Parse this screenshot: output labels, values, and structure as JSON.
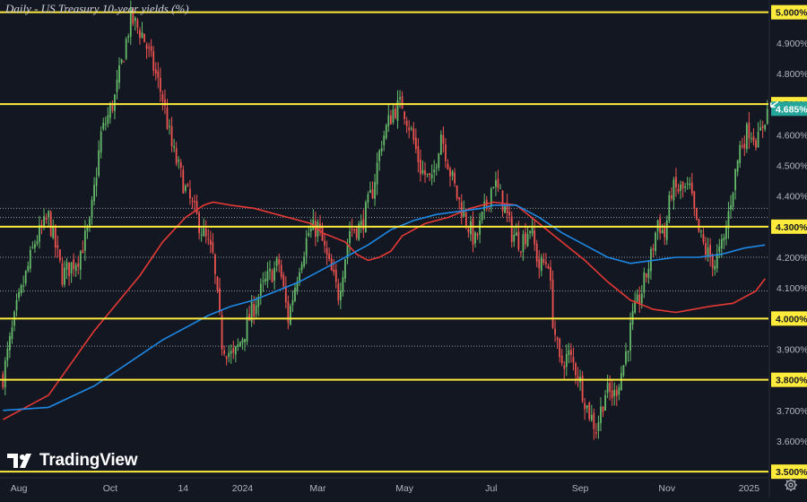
{
  "chart_data": {
    "type": "candlestick",
    "title": "Daily - US Treasury 10-year yields (%)",
    "ylim": [
      3.48,
      5.04
    ],
    "y_ticks": [
      "5.000%",
      "4.900%",
      "4.800%",
      "4.700%",
      "4.600%",
      "4.500%",
      "4.400%",
      "4.300%",
      "4.200%",
      "4.100%",
      "4.000%",
      "3.900%",
      "3.800%",
      "3.700%",
      "3.600%",
      "3.500%"
    ],
    "y_tick_values": [
      5.0,
      4.9,
      4.8,
      4.7,
      4.6,
      4.5,
      4.4,
      4.3,
      4.2,
      4.1,
      4.0,
      3.9,
      3.8,
      3.7,
      3.6,
      3.5
    ],
    "x_ticks": [
      "Aug",
      "Oct",
      "14",
      "2024",
      "Mar",
      "May",
      "Jul",
      "Sep",
      "Nov",
      "2025"
    ],
    "x_tick_index": [
      7,
      47,
      79,
      105,
      138,
      176,
      214,
      253,
      291,
      327
    ],
    "num_bars": 336,
    "current_price": {
      "label": "4.685%",
      "value": 4.685
    },
    "horizontal_levels": [
      {
        "value": 5.0,
        "label": "5.000%",
        "style": "solid"
      },
      {
        "value": 4.7,
        "label": "4.700%",
        "style": "solid"
      },
      {
        "value": 4.3,
        "label": "4.300%",
        "style": "solid"
      },
      {
        "value": 4.0,
        "label": "4.000%",
        "style": "solid"
      },
      {
        "value": 3.8,
        "label": "3.800%",
        "style": "solid"
      },
      {
        "value": 3.5,
        "label": "3.500%",
        "style": "solid"
      }
    ],
    "dotted_levels": [
      4.36,
      4.33,
      4.2,
      4.09,
      3.91
    ],
    "close_anchors": [
      [
        0,
        3.81
      ],
      [
        6,
        4.03
      ],
      [
        14,
        4.25
      ],
      [
        20,
        4.33
      ],
      [
        26,
        4.14
      ],
      [
        33,
        4.2
      ],
      [
        38,
        4.3
      ],
      [
        43,
        4.6
      ],
      [
        49,
        4.72
      ],
      [
        56,
        4.98
      ],
      [
        61,
        4.93
      ],
      [
        66,
        4.82
      ],
      [
        70,
        4.72
      ],
      [
        74,
        4.56
      ],
      [
        80,
        4.42
      ],
      [
        86,
        4.31
      ],
      [
        92,
        4.2
      ],
      [
        96,
        3.92
      ],
      [
        101,
        3.87
      ],
      [
        106,
        3.96
      ],
      [
        111,
        4.06
      ],
      [
        116,
        4.13
      ],
      [
        121,
        4.18
      ],
      [
        125,
        4.0
      ],
      [
        130,
        4.18
      ],
      [
        134,
        4.28
      ],
      [
        138,
        4.3
      ],
      [
        143,
        4.17
      ],
      [
        147,
        4.08
      ],
      [
        152,
        4.29
      ],
      [
        157,
        4.3
      ],
      [
        162,
        4.42
      ],
      [
        166,
        4.58
      ],
      [
        171,
        4.68
      ],
      [
        175,
        4.7
      ],
      [
        179,
        4.61
      ],
      [
        183,
        4.49
      ],
      [
        188,
        4.44
      ],
      [
        192,
        4.61
      ],
      [
        196,
        4.48
      ],
      [
        199,
        4.4
      ],
      [
        203,
        4.32
      ],
      [
        207,
        4.25
      ],
      [
        211,
        4.35
      ],
      [
        215,
        4.45
      ],
      [
        219,
        4.38
      ],
      [
        223,
        4.28
      ],
      [
        227,
        4.25
      ],
      [
        231,
        4.3
      ],
      [
        235,
        4.17
      ],
      [
        239,
        4.19
      ],
      [
        241,
        4.0
      ],
      [
        244,
        3.85
      ],
      [
        248,
        3.88
      ],
      [
        252,
        3.82
      ],
      [
        256,
        3.71
      ],
      [
        260,
        3.64
      ],
      [
        264,
        3.76
      ],
      [
        268,
        3.75
      ],
      [
        272,
        3.85
      ],
      [
        276,
        4.0
      ],
      [
        280,
        4.09
      ],
      [
        284,
        4.2
      ],
      [
        287,
        4.32
      ],
      [
        290,
        4.27
      ],
      [
        293,
        4.42
      ],
      [
        297,
        4.42
      ],
      [
        301,
        4.42
      ],
      [
        304,
        4.3
      ],
      [
        308,
        4.22
      ],
      [
        312,
        4.18
      ],
      [
        316,
        4.25
      ],
      [
        319,
        4.39
      ],
      [
        323,
        4.56
      ],
      [
        327,
        4.62
      ],
      [
        331,
        4.58
      ],
      [
        335,
        4.685
      ]
    ],
    "series": [
      {
        "name": "",
        "color": "#e53935",
        "points": [
          [
            0,
            3.67
          ],
          [
            20,
            3.75
          ],
          [
            40,
            3.96
          ],
          [
            60,
            4.14
          ],
          [
            70,
            4.25
          ],
          [
            80,
            4.33
          ],
          [
            88,
            4.37
          ],
          [
            92,
            4.38
          ],
          [
            100,
            4.37
          ],
          [
            110,
            4.36
          ],
          [
            120,
            4.34
          ],
          [
            135,
            4.31
          ],
          [
            140,
            4.28
          ],
          [
            150,
            4.25
          ],
          [
            155,
            4.21
          ],
          [
            160,
            4.19
          ],
          [
            165,
            4.2
          ],
          [
            170,
            4.22
          ],
          [
            175,
            4.27
          ],
          [
            185,
            4.31
          ],
          [
            195,
            4.33
          ],
          [
            205,
            4.36
          ],
          [
            215,
            4.38
          ],
          [
            225,
            4.37
          ],
          [
            235,
            4.31
          ],
          [
            245,
            4.25
          ],
          [
            255,
            4.19
          ],
          [
            265,
            4.12
          ],
          [
            275,
            4.06
          ],
          [
            285,
            4.03
          ],
          [
            295,
            4.02
          ],
          [
            310,
            4.04
          ],
          [
            320,
            4.05
          ],
          [
            330,
            4.09
          ],
          [
            334,
            4.13
          ]
        ]
      },
      {
        "name": "",
        "color": "#1e88e5",
        "points": [
          [
            0,
            3.7
          ],
          [
            20,
            3.71
          ],
          [
            40,
            3.78
          ],
          [
            60,
            3.88
          ],
          [
            70,
            3.93
          ],
          [
            80,
            3.97
          ],
          [
            90,
            4.01
          ],
          [
            100,
            4.04
          ],
          [
            110,
            4.06
          ],
          [
            120,
            4.09
          ],
          [
            130,
            4.12
          ],
          [
            140,
            4.16
          ],
          [
            150,
            4.2
          ],
          [
            160,
            4.24
          ],
          [
            170,
            4.29
          ],
          [
            180,
            4.32
          ],
          [
            190,
            4.34
          ],
          [
            200,
            4.35
          ],
          [
            210,
            4.36
          ],
          [
            215,
            4.37
          ],
          [
            225,
            4.37
          ],
          [
            235,
            4.33
          ],
          [
            245,
            4.28
          ],
          [
            255,
            4.24
          ],
          [
            265,
            4.2
          ],
          [
            275,
            4.18
          ],
          [
            285,
            4.19
          ],
          [
            295,
            4.2
          ],
          [
            305,
            4.2
          ],
          [
            315,
            4.21
          ],
          [
            325,
            4.23
          ],
          [
            334,
            4.24
          ]
        ]
      }
    ]
  },
  "branding": {
    "name": "TradingView"
  }
}
